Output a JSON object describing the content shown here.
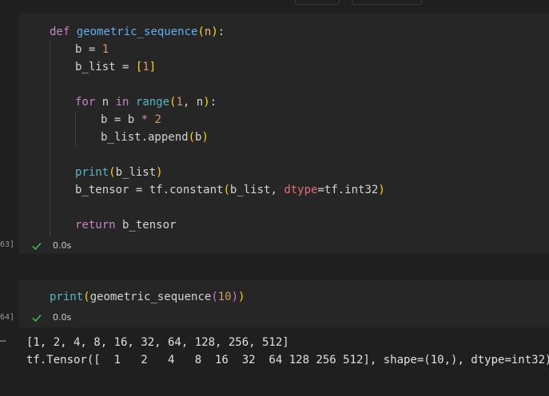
{
  "cell1": {
    "exec_count": "63]",
    "duration": "0.0s",
    "lines": [
      "def geometric_sequence(n):",
      "b = 1",
      "b_list = [1]",
      "",
      "for n in range(1, n):",
      "b = b * 2",
      "b_list.append(b)",
      "",
      "print(b_list)",
      "b_tensor = tf.constant(b_list, dtype=tf.int32)",
      "",
      "return b_tensor"
    ]
  },
  "cell2": {
    "exec_count": "64]",
    "duration": "0.0s",
    "code": "print(geometric_sequence(10))"
  },
  "output": {
    "marker": "…",
    "lines": [
      "[1, 2, 4, 8, 16, 32, 64, 128, 256, 512]",
      "tf.Tensor([  1   2   4   8  16  32  64 128 256 512], shape=(10,), dtype=int32)"
    ]
  },
  "colors": {
    "background": "#1f1f1f",
    "cell_background": "#262626",
    "success_check": "#3fb950"
  }
}
